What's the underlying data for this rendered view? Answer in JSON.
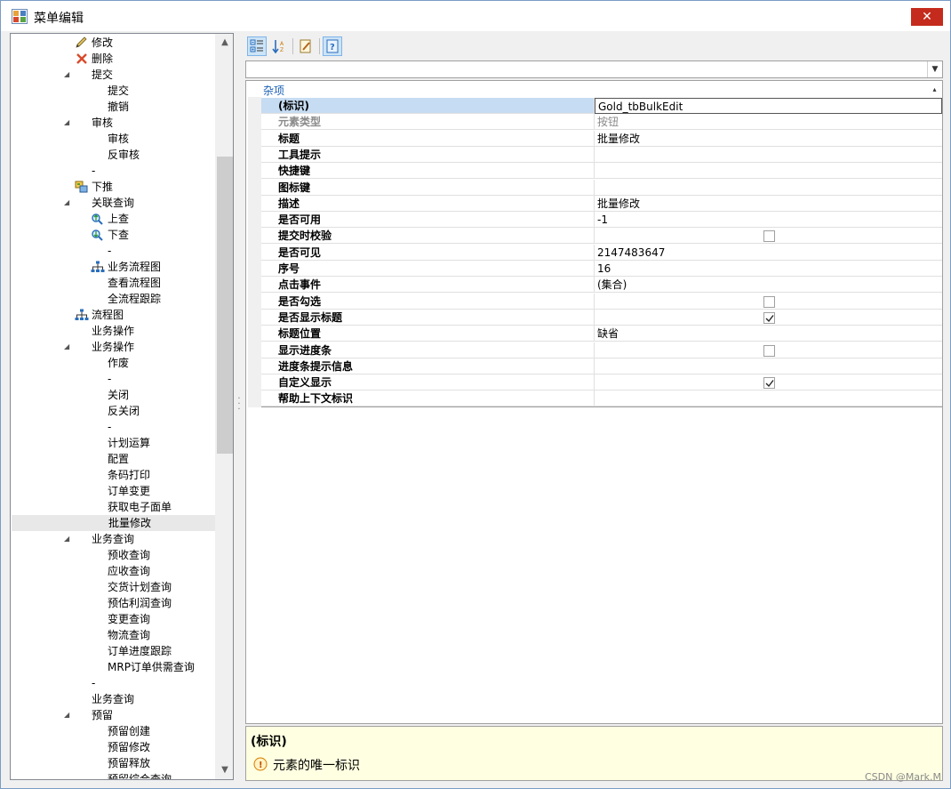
{
  "window": {
    "title": "菜单编辑",
    "close_glyph": "✕"
  },
  "tree": {
    "items": [
      {
        "label": "修改",
        "level": 2,
        "icon": "pencil-icon"
      },
      {
        "label": "删除",
        "level": 2,
        "icon": "delete-x-icon"
      },
      {
        "label": "提交",
        "level": 2,
        "expander": "◢"
      },
      {
        "label": "提交",
        "level": 3
      },
      {
        "label": "撤销",
        "level": 3
      },
      {
        "label": "审核",
        "level": 2,
        "expander": "◢"
      },
      {
        "label": "审核",
        "level": 3
      },
      {
        "label": "反审核",
        "level": 3
      },
      {
        "label": "-",
        "level": 2
      },
      {
        "label": "下推",
        "level": 2,
        "icon": "push-down-icon"
      },
      {
        "label": "关联查询",
        "level": 2,
        "expander": "◢"
      },
      {
        "label": "上查",
        "level": 3,
        "icon": "search-up-icon"
      },
      {
        "label": "下查",
        "level": 3,
        "icon": "search-down-icon"
      },
      {
        "label": "-",
        "level": 3
      },
      {
        "label": "业务流程图",
        "level": 3,
        "icon": "flowchart-icon"
      },
      {
        "label": "查看流程图",
        "level": 3
      },
      {
        "label": "全流程跟踪",
        "level": 3
      },
      {
        "label": "流程图",
        "level": 2,
        "icon": "flowchart-icon"
      },
      {
        "label": "业务操作",
        "level": 2
      },
      {
        "label": "业务操作",
        "level": 2,
        "expander": "◢"
      },
      {
        "label": "作废",
        "level": 3
      },
      {
        "label": "-",
        "level": 3
      },
      {
        "label": "关闭",
        "level": 3
      },
      {
        "label": "反关闭",
        "level": 3
      },
      {
        "label": "-",
        "level": 3
      },
      {
        "label": "计划运算",
        "level": 3
      },
      {
        "label": "配置",
        "level": 3
      },
      {
        "label": "条码打印",
        "level": 3
      },
      {
        "label": "订单变更",
        "level": 3
      },
      {
        "label": "获取电子面单",
        "level": 3
      },
      {
        "label": "批量修改",
        "level": 3,
        "selected": true
      },
      {
        "label": "业务查询",
        "level": 2,
        "expander": "◢"
      },
      {
        "label": "预收查询",
        "level": 3
      },
      {
        "label": "应收查询",
        "level": 3
      },
      {
        "label": "交货计划查询",
        "level": 3
      },
      {
        "label": "预估利润查询",
        "level": 3
      },
      {
        "label": "变更查询",
        "level": 3
      },
      {
        "label": "物流查询",
        "level": 3
      },
      {
        "label": "订单进度跟踪",
        "level": 3
      },
      {
        "label": "MRP订单供需查询",
        "level": 3
      },
      {
        "label": "-",
        "level": 2
      },
      {
        "label": "业务查询",
        "level": 2
      },
      {
        "label": "预留",
        "level": 2,
        "expander": "◢"
      },
      {
        "label": "预留创建",
        "level": 3
      },
      {
        "label": "预留修改",
        "level": 3
      },
      {
        "label": "预留释放",
        "level": 3
      },
      {
        "label": "预留综合查询",
        "level": 3
      }
    ],
    "scroll_up_glyph": "▲",
    "scroll_down_glyph": "▼"
  },
  "toolbar": {
    "buttons": [
      {
        "name": "categorized-icon",
        "active": true
      },
      {
        "name": "alphabetical-icon",
        "active": false
      },
      {
        "name": "property-pages-icon",
        "active": false
      },
      {
        "name": "help-icon",
        "active": true
      }
    ]
  },
  "object_select": {
    "value": "",
    "arrow": "▼"
  },
  "grid": {
    "category": "杂项",
    "collapse_glyph": "▴",
    "rows": [
      {
        "name": "(标识)",
        "value": "Gold_tbBulkEdit",
        "selected": true,
        "editing": true
      },
      {
        "name": "元素类型",
        "value": "按钮",
        "dim": true
      },
      {
        "name": "标题",
        "value": "批量修改"
      },
      {
        "name": "工具提示",
        "value": ""
      },
      {
        "name": "快捷键",
        "value": ""
      },
      {
        "name": "图标键",
        "value": ""
      },
      {
        "name": "描述",
        "value": "批量修改"
      },
      {
        "name": "是否可用",
        "value": "-1"
      },
      {
        "name": "提交时校验",
        "value": "",
        "checkbox": true,
        "checked": false
      },
      {
        "name": "是否可见",
        "value": "2147483647"
      },
      {
        "name": "序号",
        "value": "16"
      },
      {
        "name": "点击事件",
        "value": "(集合)"
      },
      {
        "name": "是否勾选",
        "value": "",
        "checkbox": true,
        "checked": false
      },
      {
        "name": "是否显示标题",
        "value": "",
        "checkbox": true,
        "checked": true
      },
      {
        "name": "标题位置",
        "value": "缺省"
      },
      {
        "name": "显示进度条",
        "value": "",
        "checkbox": true,
        "checked": false
      },
      {
        "name": "进度条提示信息",
        "value": ""
      },
      {
        "name": "自定义显示",
        "value": "",
        "checkbox": true,
        "checked": true
      },
      {
        "name": "帮助上下文标识",
        "value": ""
      }
    ]
  },
  "description": {
    "title": "(标识)",
    "text": "元素的唯一标识",
    "icon": "info-icon"
  },
  "watermark": "CSDN @Mark.M",
  "colors": {
    "selection": "#c6dcf2",
    "category_text": "#1a5fb4",
    "description_bg": "#ffffe1",
    "close_red": "#c42b1c"
  }
}
